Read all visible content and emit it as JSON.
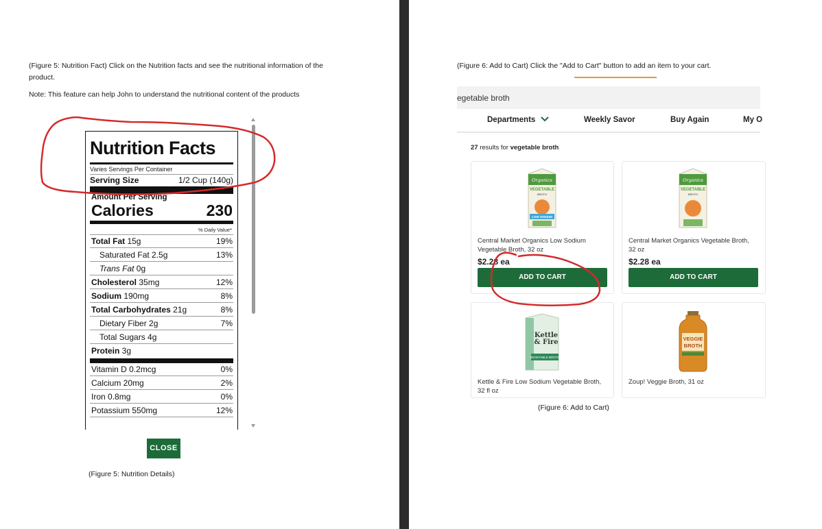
{
  "left": {
    "caption_line1": "(Figure 5: Nutrition Fact) Click on the Nutrition facts and see the nutritional information of the",
    "caption_line2": "product.",
    "note": "Note: This feature can help John to understand the nutritional content of the products",
    "nutrition": {
      "title": "Nutrition Facts",
      "servings_per_container": "Varies Servings Per Container",
      "serving_size_label": "Serving Size",
      "serving_size_value": "1/2 Cup (140g)",
      "amount_per_serving": "Amount Per Serving",
      "calories_label": "Calories",
      "calories_value": "230",
      "daily_value_header": "% Daily Value*",
      "rows": [
        {
          "label": "Total Fat",
          "amount": "15g",
          "dv": "19%"
        },
        {
          "label": "Saturated Fat",
          "amount": "2.5g",
          "dv": "13%"
        },
        {
          "label": "Trans Fat",
          "amount": "0g",
          "dv": ""
        },
        {
          "label": "Cholesterol",
          "amount": "35mg",
          "dv": "12%"
        },
        {
          "label": "Sodium",
          "amount": "190mg",
          "dv": "8%"
        },
        {
          "label": "Total Carbohydrates",
          "amount": "21g",
          "dv": "8%"
        },
        {
          "label": "Dietary Fiber",
          "amount": "2g",
          "dv": "7%"
        },
        {
          "label": "Total Sugars",
          "amount": "4g",
          "dv": ""
        },
        {
          "label": "Protein",
          "amount": "3g",
          "dv": ""
        },
        {
          "label": "Vitamin D",
          "amount": "0.2mcg",
          "dv": "0%"
        },
        {
          "label": "Calcium",
          "amount": "20mg",
          "dv": "2%"
        },
        {
          "label": "Iron",
          "amount": "0.8mg",
          "dv": "0%"
        },
        {
          "label": "Potassium",
          "amount": "550mg",
          "dv": "12%"
        }
      ]
    },
    "close_label": "CLOSE",
    "bottom_caption": "(Figure 5: Nutrition Details)"
  },
  "right": {
    "caption": "(Figure 6: Add to Cart) Click the \"Add to Cart\" button to add an item to your cart.",
    "search_text": "egetable broth",
    "nav": {
      "departments": "Departments",
      "weekly_savor": "Weekly Savor",
      "buy_again": "Buy Again",
      "my": "My O"
    },
    "results_count": "27",
    "results_text": "results for",
    "results_query": "vegetable broth",
    "products": [
      {
        "name_line1": "Central Market Organics Low Sodium",
        "name_line2": "Vegetable Broth, 32 oz",
        "price": "$2.28 ea",
        "button": "ADD TO CART"
      },
      {
        "name_line1": "Central Market Organics Vegetable Broth,",
        "name_line2": "32 oz",
        "price": "$2.28 ea",
        "button": "ADD TO CART"
      },
      {
        "name_line1": "Kettle & Fire Low Sodium Vegetable Broth,",
        "name_line2": "32 fl oz"
      },
      {
        "name_line1": "Zoup! Veggie Broth, 31 oz",
        "name_line2": ""
      }
    ],
    "bottom_caption": "(Figure 6: Add to Cart)",
    "pack_labels": {
      "organics": "Organics",
      "vegetable": "VEGETABLE",
      "broth": "BROTH",
      "low_sodium": "LOW SODIUM",
      "kettle": "Kettle",
      "fire": "& Fire",
      "kf_vegetable": "VEGETABLE BROTH",
      "veggie": "VEGGIE",
      "zoup_broth": "BROTH"
    }
  },
  "colors": {
    "green": "#1e6b3a",
    "annotation_red": "#d42a2a",
    "divider": "#2b2b2b",
    "accent": "#e8953a"
  }
}
